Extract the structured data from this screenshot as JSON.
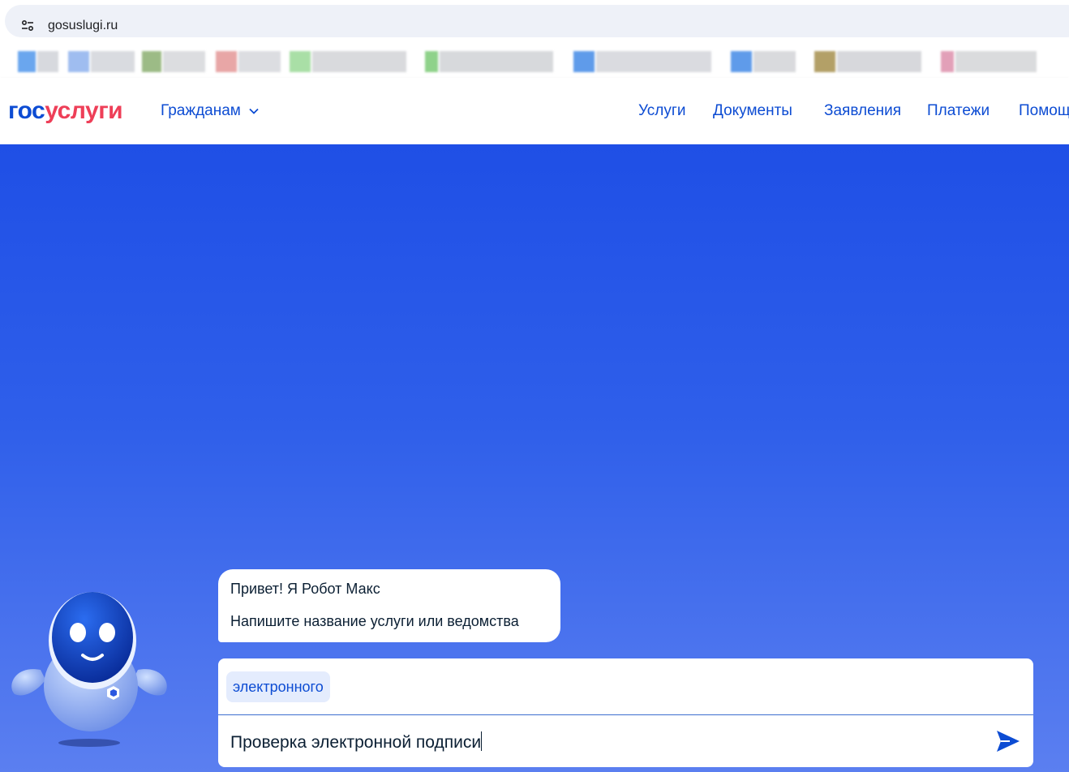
{
  "browser": {
    "url": "gosuslugi.ru",
    "site_info_icon": "site-settings-icon"
  },
  "header": {
    "logo_part1": "гос",
    "logo_part2": "услуги",
    "audience_selector": "Гражданам",
    "nav": [
      "Услуги",
      "Документы",
      "Заявления",
      "Платежи",
      "Помощ"
    ]
  },
  "chat": {
    "greeting": "Привет! Я Робот Макс",
    "prompt": "Напишите название услуги или ведомства",
    "suggestion_chip": "электронного",
    "query_value": "Проверка электронной подписи",
    "send_icon": "send-arrow-icon"
  },
  "colors": {
    "brand_blue": "#0d4cd3",
    "brand_red": "#ee3f58",
    "hero_top": "#1f4fe6",
    "hero_bottom": "#5b7ff0"
  }
}
